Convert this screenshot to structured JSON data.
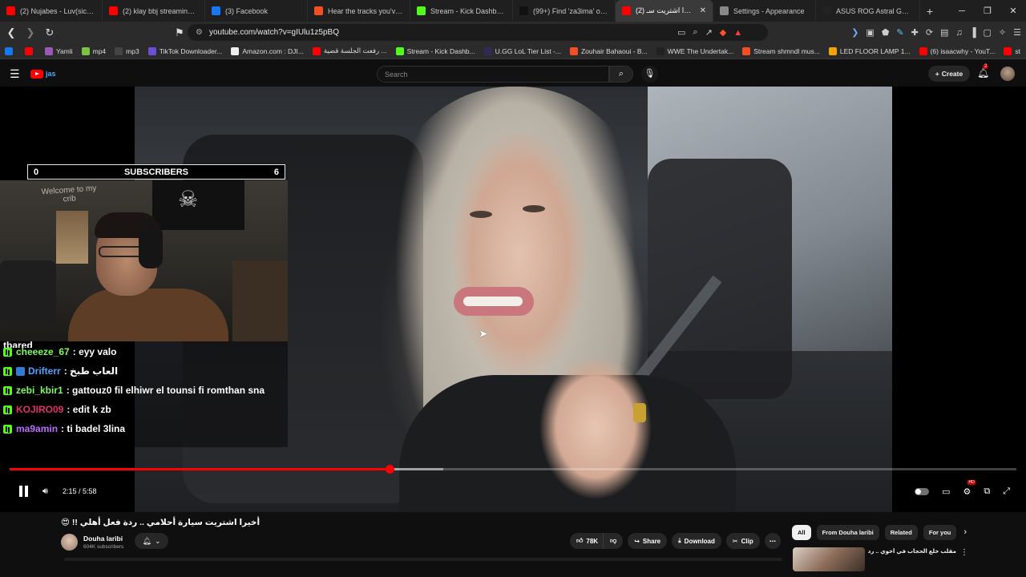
{
  "browser": {
    "tabs": [
      {
        "label": "(2) Nujabes - Luv(sic) P",
        "fav": "#ff0000"
      },
      {
        "label": "(2) klay bbj streaming - Yo",
        "fav": "#ff0000"
      },
      {
        "label": "(3) Facebook",
        "fav": "#1877f2"
      },
      {
        "label": "Hear the tracks you've liked",
        "fav": "#f25022"
      },
      {
        "label": "Stream - Kick Dashboard",
        "fav": "#53fc18"
      },
      {
        "label": "(99+) Find 'za3ima' on TikT",
        "fav": "#111111"
      },
      {
        "label": "أخيرا اشتريت سـ (2)",
        "fav": "#ff0000",
        "active": true
      },
      {
        "label": "Settings - Appearance",
        "fav": "#888888"
      },
      {
        "label": "ASUS ROG Astral GeForce",
        "fav": "#222222"
      }
    ],
    "new_tab": "+",
    "window_controls": [
      "─",
      "❐",
      "✕"
    ],
    "url": "youtube.com/watch?v=gIUlu1z5pBQ",
    "bookmarks": [
      {
        "label": "",
        "fav": "#1877f2"
      },
      {
        "label": "",
        "fav": "#ff0000"
      },
      {
        "label": "Yamli",
        "fav": "#9b59b6"
      },
      {
        "label": "mp4",
        "fav": "#7cc242"
      },
      {
        "label": "mp3",
        "fav": "#444444"
      },
      {
        "label": "TikTok Downloader...",
        "fav": "#6c4dd6"
      },
      {
        "label": "Amazon.com : DJI...",
        "fav": "#eeeeee"
      },
      {
        "label": "رفعت الجلسة قضية ...",
        "fav": "#ff0000"
      },
      {
        "label": "Stream - Kick Dashb...",
        "fav": "#53fc18"
      },
      {
        "label": "U.GG LoL Tier List -...",
        "fav": "#2c2c54"
      },
      {
        "label": "Zouhair Bahaoui - B...",
        "fav": "#f25022"
      },
      {
        "label": "WWE The Undertak...",
        "fav": "#222222"
      },
      {
        "label": "Stream shmndl mus...",
        "fav": "#f25022"
      },
      {
        "label": "LED FLOOR LAMP 1...",
        "fav": "#f4a300"
      },
      {
        "label": "(6) isaacwhy - YouT...",
        "fav": "#ff0000"
      },
      {
        "label": "st",
        "fav": "#ff0000"
      }
    ]
  },
  "youtube": {
    "logo_text": "jas",
    "search_placeholder": "Search",
    "create_label": "Create",
    "notif_count": "2"
  },
  "overlay": {
    "sub_left": "0",
    "sub_title": "SUBSCRIBERS",
    "sub_right": "6",
    "wall_text": "Welcome to my\ncrib",
    "partial_line": "tbared",
    "chat": [
      {
        "user": "cheeeze_67",
        "color": "#7cfc5a",
        "msg": ": eyy valo",
        "sub": false
      },
      {
        "user": "Drifterr",
        "color": "#4ea3ff",
        "msg": ": العاب طبخ",
        "sub": true
      },
      {
        "user": "zebi_kbir1",
        "color": "#7cfc5a",
        "msg": ": gattouz0 fil elhiwr el tounsi fi romthan sna",
        "sub": false
      },
      {
        "user": "KOJIRO09",
        "color": "#e0306a",
        "msg": ": edit k zb",
        "sub": false
      },
      {
        "user": "ma9amin",
        "color": "#b96cff",
        "msg": ": ti badel 3lina",
        "sub": false
      }
    ]
  },
  "player": {
    "time_current": "2:15",
    "time_total": "5:58",
    "time_display": "2:15 / 5:58",
    "played_fraction": 0.377,
    "buffered_fraction": 0.431
  },
  "video": {
    "title": "أخيرا اشتريت سيارة أحلامي .. ردة فعل أهلي !! 😍",
    "channel": "Douha laribi",
    "subscribers": "604K subscribers",
    "likes": "78K",
    "share": "Share",
    "download": "Download",
    "clip": "Clip"
  },
  "sidebar": {
    "chips": [
      {
        "label": "All",
        "selected": true
      },
      {
        "label": "From Douha laribi",
        "selected": false
      },
      {
        "label": "Related",
        "selected": false
      },
      {
        "label": "For you",
        "selected": false
      }
    ],
    "rec_title": "مقلب خلع الحجاب في أخوي .. ردة فعله"
  }
}
